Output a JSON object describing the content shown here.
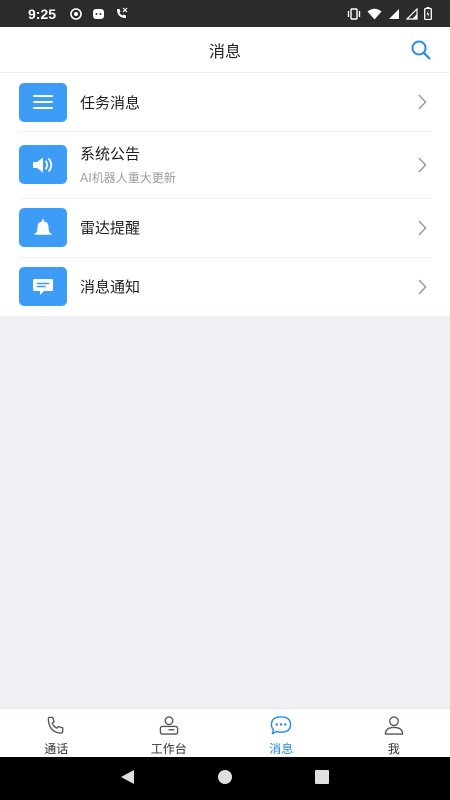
{
  "status_bar": {
    "time": "9:25",
    "left_icons": [
      "record-icon",
      "cat-app-icon",
      "phone-call-icon"
    ],
    "right_icons": [
      "vibrate-icon",
      "wifi-icon",
      "signal-icon",
      "signal-icon",
      "battery-icon"
    ]
  },
  "header": {
    "title": "消息",
    "search_icon": "search-icon"
  },
  "messages": [
    {
      "title": "任务消息",
      "subtitle": "",
      "icon": "list-icon"
    },
    {
      "title": "系统公告",
      "subtitle": "AI机器人重大更新",
      "icon": "speaker-icon"
    },
    {
      "title": "雷达提醒",
      "subtitle": "",
      "icon": "bell-icon"
    },
    {
      "title": "消息通知",
      "subtitle": "",
      "icon": "chat-icon"
    }
  ],
  "bottom_nav": [
    {
      "label": "通话",
      "icon": "phone-icon",
      "active": false
    },
    {
      "label": "工作台",
      "icon": "workbench-icon",
      "active": false
    },
    {
      "label": "消息",
      "icon": "message-icon",
      "active": true
    },
    {
      "label": "我",
      "icon": "user-icon",
      "active": false
    }
  ],
  "colors": {
    "accent": "#2a8be8",
    "icon_bg": "#3d9cf5",
    "page_bg": "#eef0f3"
  }
}
